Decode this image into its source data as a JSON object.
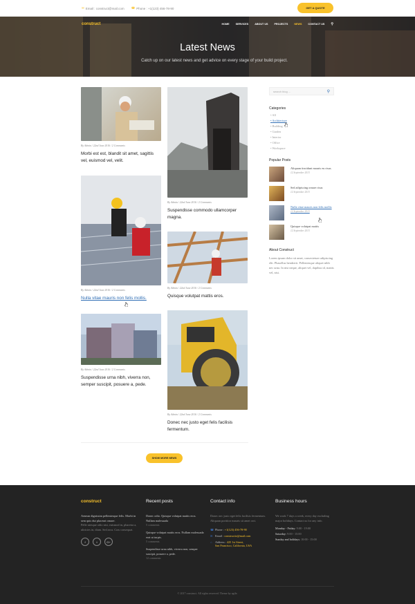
{
  "topbar": {
    "email": "Email : construct@mail.com",
    "phone": "Phone : +1(123) 456-78-90",
    "quote_button": "GET A QUOTE"
  },
  "nav": {
    "logo": "construct",
    "items": [
      "HOME",
      "SERVICES",
      "ABOUT US",
      "PROJECTS",
      "NEWS",
      "CONTACT US"
    ],
    "active": "NEWS"
  },
  "hero": {
    "title": "Latest News",
    "subtitle": "Catch up on our latest news and get advice on every stage of your build project."
  },
  "posts": [
    {
      "meta": "By Admin / 22nd June 2016 / 2 Comments",
      "title": "Morbi est est, blandit sit amet, sagittis vel, euismod vel, velit."
    },
    {
      "meta": "By Admin / 22nd June 2016 / 2 Comments",
      "title": "Nulla vitae mauris non felis mollis."
    },
    {
      "meta": "By Admin / 22nd June 2016 / 2 Comments",
      "title": "Suspendisse urna nibh, viverra non, semper suscipit, posuere a, pede."
    },
    {
      "meta": "By Admin / 22nd June 2016 / 2 Comments",
      "title": "Suspendisse commodo ullamcorper magna."
    },
    {
      "meta": "By Admin / 22nd June 2016 / 2 Comments",
      "title": "Quisque volutpat mattis eros."
    },
    {
      "meta": "By Admin / 22nd June 2016 / 2 Comments",
      "title": "Donec nec justo eget felis facilisis fermentum."
    }
  ],
  "more_button": "SHOW MORE NEWS",
  "sidebar": {
    "search_placeholder": "search blog ...",
    "categories_title": "Categories",
    "categories": [
      "All",
      "Architecture",
      "Building",
      "Garden",
      "Interior",
      "Office",
      "Workspace"
    ],
    "popular_title": "Popular Posts",
    "popular": [
      {
        "title": "Aliquam tincidunt mauris eu risus.",
        "date": "12 September 2013"
      },
      {
        "title": "Sed adipiscing ornare risus",
        "date": "12 September 2013"
      },
      {
        "title": "Nulla vitae mauris non felis mollis",
        "date": "12 September 2013"
      },
      {
        "title": "Quisque volutpat mattis",
        "date": "12 September 2013"
      }
    ],
    "about_title": "About Construct",
    "about_text": "Lorem ipsum dolor sit amet, consectetuer adipiscing elit. Phasellus hendrerit. Pellentesque aliquet nibh nec urna. In nisi neque, aliquet vel, dapibus id, mattis vel, nisi."
  },
  "footer": {
    "brand": "construct",
    "brand_text_1": "Aenean dignissim pellentesque felis. Morbi in sem quis dui placerat ornare.",
    "brand_text_2": "Pelle ntesque odio nisi, euismod in, pharetra a, ultricies in, diam. Sed arcu. Cras consequat.",
    "recent_title": "Recent posts",
    "recent": [
      {
        "title": "Donec odio. Quisque volutpat mattis eros. Nullam malesuada",
        "date": "5 comments"
      },
      {
        "title": "Quisque volutpat mattis eros. Nullam malesuada erat ut turpis.",
        "date": "5 comments"
      },
      {
        "title": "Suspendisse urna nibh, viverra non, semper suscipit, posuere a, pede.",
        "date": "12 comments"
      }
    ],
    "contact_title": "Contact info",
    "contact_text": "Donec nec justo eget felis facilisis fermentum. Aliquam porttitor mauris sit amet orci.",
    "phone_label": "Phone :",
    "phone": "+1(123) 456-78-90",
    "email_label": "Email :",
    "email": "constructio@mail.com",
    "address_label": "Address :",
    "address_1": "425 1st Street,",
    "address_2": "San Francisco, California, USA",
    "hours_title": "Business hours",
    "hours_text": "We work 7 days a week, every day excluding major holidays. Contact us for any info.",
    "hours": [
      {
        "day": "Monday - Friday:",
        "time": "9:00 - 19:00"
      },
      {
        "day": "Saturday:",
        "time": "9:00 - 15:00"
      },
      {
        "day": "Sunday and holidays:",
        "time": "10:00 - 15:00"
      }
    ],
    "copyright": "© 2017 construct. All rights reserved. Theme by agile."
  },
  "colors": {
    "accent": "#f9c22b",
    "link": "#2e6db4",
    "footer_bg": "#232323"
  }
}
